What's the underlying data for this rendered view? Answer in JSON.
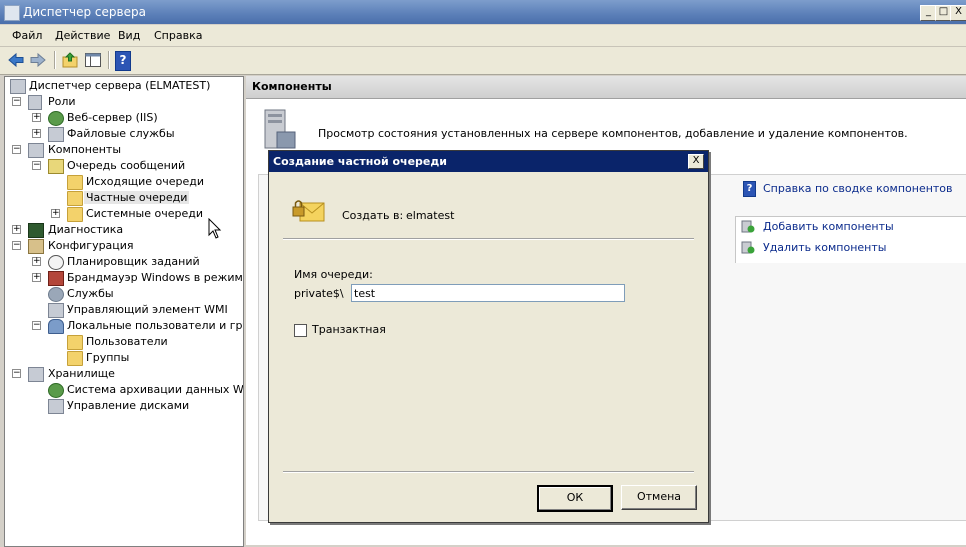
{
  "window": {
    "title": "Диспетчер сервера",
    "buttons": {
      "minimize": "_",
      "maximize": "□",
      "close": "X"
    }
  },
  "menu": [
    "Файл",
    "Действие",
    "Вид",
    "Справка"
  ],
  "toolbar": {
    "icons": [
      "back-arrow-icon",
      "forward-arrow-icon",
      "up-folder-icon",
      "show-hide-tree-icon",
      "help-icon"
    ],
    "help_glyph": "?"
  },
  "tree": {
    "items": [
      {
        "label": "Диспетчер сервера (ELMATEST)"
      },
      {
        "label": "Роли",
        "expander": "−"
      },
      {
        "label": "Веб-сервер (IIS)",
        "expander": "+"
      },
      {
        "label": "Файловые службы",
        "expander": "+"
      },
      {
        "label": "Компоненты",
        "expander": "−"
      },
      {
        "label": "Очередь сообщений",
        "expander": "−"
      },
      {
        "label": "Исходящие очереди"
      },
      {
        "label": "Частные очереди"
      },
      {
        "label": "Системные очереди",
        "expander": "+"
      },
      {
        "label": "Диагностика",
        "expander": "+"
      },
      {
        "label": "Конфигурация",
        "expander": "−"
      },
      {
        "label": "Планировщик заданий",
        "expander": "+"
      },
      {
        "label": "Брандмауэр Windows в режиме пов",
        "expander": "+"
      },
      {
        "label": "Службы"
      },
      {
        "label": "Управляющий элемент WMI"
      },
      {
        "label": "Локальные пользователи и группы",
        "expander": "−"
      },
      {
        "label": "Пользователи"
      },
      {
        "label": "Группы"
      },
      {
        "label": "Хранилище",
        "expander": "−"
      },
      {
        "label": "Система архивации данных Windo"
      },
      {
        "label": "Управление дисками"
      }
    ]
  },
  "right_pane": {
    "header": "Компоненты",
    "description": "Просмотр состояния установленных на сервере компонентов, добавление и удаление компонентов.",
    "help_link": "Справка по сводке компонентов",
    "actions": [
      "Добавить компоненты",
      "Удалить компоненты"
    ]
  },
  "dialog": {
    "title": "Создание частной очереди",
    "close_glyph": "X",
    "create_in_label": "Создать в:",
    "create_in_value": "elmatest",
    "queue_name_label": "Имя очереди:",
    "queue_prefix": "private$\\",
    "queue_name_value": "test",
    "transactional_label": "Транзактная",
    "transactional_checked": false,
    "ok_label": "ОК",
    "cancel_label": "Отмена"
  }
}
